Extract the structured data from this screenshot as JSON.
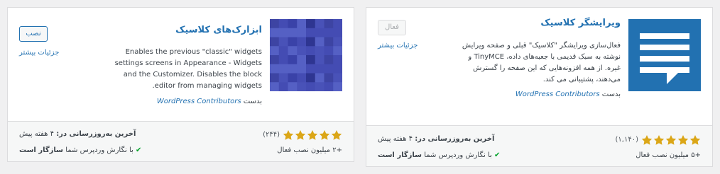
{
  "cards": [
    {
      "title": "ابزارک‌های کلاسیک",
      "description": "Enables the previous \"classic\" widgets settings screens in Appearance - Widgets and the Customizer. Disables the block editor from managing widgets.",
      "by_label": "بدست",
      "author": "WordPress Contributors",
      "action_label": "نصب",
      "more_label": "جزئیات بیشتر",
      "rating": 5,
      "rating_count": "(۲۴۴)",
      "installs": "+۲ میلیون نصب فعال",
      "updated_label": "آخرین به‌روزرسانی در:",
      "updated_value": "۴ هفته پیش",
      "compat_prefix": "با نگارش وردپرس شما",
      "compat_value": "سازگار است",
      "thumb_colors": [
        "#3d44a3",
        "#4952b8",
        "#2e3591",
        "#5560c4",
        "#3a42a8",
        "#444cb3"
      ]
    },
    {
      "title": "ویرایشگر کلاسیک",
      "description": "فعال‌سازی ویرایشگر \"کلاسیک\" قبلی و صفحه ویرایش نوشته به سبک قدیمی با جعبه‌های داده، TinyMCE و غیره. از همه افزونه‌هایی که این صفحه را گسترش می‌دهند، پشتیبانی می کند.",
      "by_label": "بدست",
      "author": "WordPress Contributors",
      "action_label": "فعال",
      "more_label": "جزئیات بیشتر",
      "rating": 5,
      "rating_count": "(۱,۱۴۰)",
      "installs": "+۵ میلیون نصب فعال",
      "updated_label": "آخرین به‌روزرسانی در:",
      "updated_value": "۴ هفته پیش",
      "compat_prefix": "با نگارش وردپرس شما",
      "compat_value": "سازگار است",
      "thumb_color": "#2271b1"
    }
  ]
}
